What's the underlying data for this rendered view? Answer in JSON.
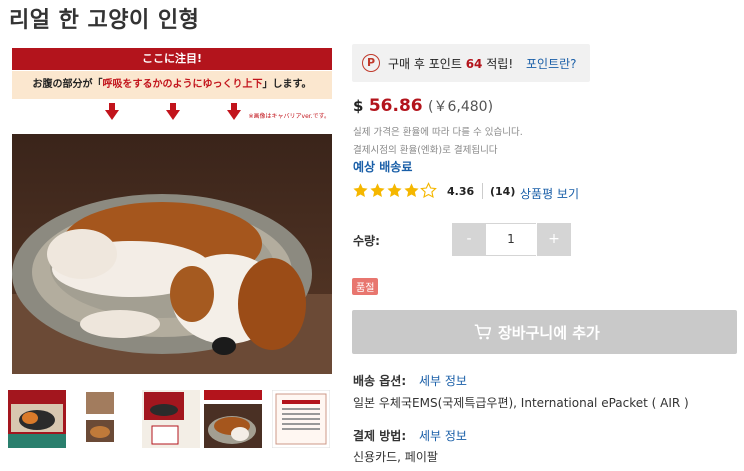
{
  "product": {
    "title": "리얼 한 고양이 인형"
  },
  "image": {
    "banner_text": "ここに注目!",
    "sub_prefix": "お腹の部分が「",
    "sub_highlight": "呼吸をするかのようにゆっくり上下",
    "sub_suffix": "」します。",
    "note_text": "※画像はキャバリアver.です。"
  },
  "thumbnails": [
    {
      "name": "thumbnail-1"
    },
    {
      "name": "thumbnail-2"
    },
    {
      "name": "thumbnail-3"
    },
    {
      "name": "thumbnail-4"
    },
    {
      "name": "thumbnail-5"
    }
  ],
  "points": {
    "icon": "P",
    "text_before": "구매 후 포인트",
    "amount": "64",
    "text_after": "적립!",
    "link": "포인트란?"
  },
  "price": {
    "currency": "$",
    "amount": "56.86",
    "secondary": "(￥6,480)",
    "note1": "실제 가격은 환율에 따라 다를 수 있습니다.",
    "note2": "결제시점의 환율(엔화)로 결제됩니다",
    "shipping_fee_link": "예상 배송료"
  },
  "rating": {
    "stars": 4,
    "max": 5,
    "value": "4.36",
    "count": "(14)",
    "reviews_link": "상품평 보기",
    "star_color": "#f5b700"
  },
  "quantity": {
    "label": "수량:",
    "minus": "-",
    "value": "1",
    "plus": "+"
  },
  "status": {
    "badge": "품절"
  },
  "cart": {
    "label": "장바구니에 추가",
    "icon": "cart-icon"
  },
  "shipping": {
    "label": "배송 옵션:",
    "link": "세부 정보",
    "value": "일본 우체국EMS(국제특급우편), International ePacket ( AIR )"
  },
  "payment": {
    "label": "결제 방법:",
    "link": "세부 정보",
    "value": "신용카드, 페이팔"
  },
  "colors": {
    "accent_red": "#b3141c",
    "link_blue": "#1a5fa8",
    "button_disabled": "#c9c9c9",
    "badge": "#e8766f"
  }
}
